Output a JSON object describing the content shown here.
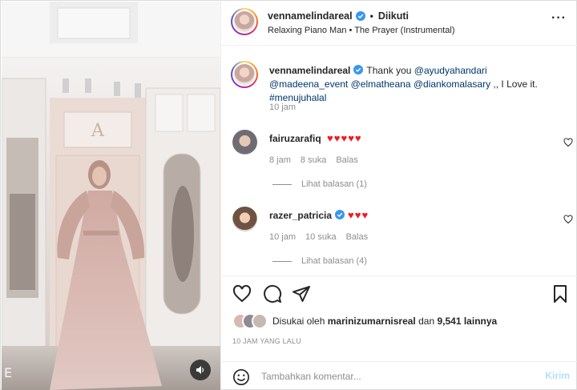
{
  "post": {
    "header": {
      "username": "vennamelindareal",
      "separator": "•",
      "follow_status": "Diikuti",
      "audio": "Relaxing Piano Man • The Prayer (Instrumental)",
      "more_icon": "more-horizontal-icon"
    },
    "caption": {
      "username": "vennamelindareal",
      "text_prefix": "Thank you",
      "mentions": [
        "@ayudyahandari",
        "@madeena_event",
        "@elmatheana",
        "@diankomalasary"
      ],
      "text_suffix": ",, I Love it.",
      "hashtag": "#menujuhalal",
      "time": "10 jam"
    },
    "comments": [
      {
        "username": "fairuzarafiq",
        "text": "♥♥♥♥♥",
        "time": "8 jam",
        "likes": "8 suka",
        "reply_label": "Balas",
        "view_replies": "Lihat balasan (1)"
      },
      {
        "username": "razer_patricia",
        "text": "♥♥♥",
        "time": "10 jam",
        "likes": "10 suka",
        "reply_label": "Balas",
        "view_replies": "Lihat balasan (4)"
      }
    ],
    "actions": {
      "like_icon": "heart-icon",
      "comment_icon": "comment-icon",
      "share_icon": "share-icon",
      "save_icon": "bookmark-icon"
    },
    "likes": {
      "prefix": "Disukai oleh",
      "liker": "marinizumarnisreal",
      "conjunction": "dan",
      "count": "9,541 lainnya"
    },
    "timestamp": "10 JAM YANG LALU",
    "add_comment": {
      "placeholder": "Tambahkan komentar...",
      "post_label": "Kirim"
    },
    "media": {
      "edge_letter": "E",
      "mute_icon": "speaker-icon"
    }
  },
  "colors": {
    "link": "#00376b",
    "heart": "#ed1c24",
    "verified": "#3897f0",
    "muted_text": "#8e8e8e",
    "post_button": "#b2dffc"
  }
}
